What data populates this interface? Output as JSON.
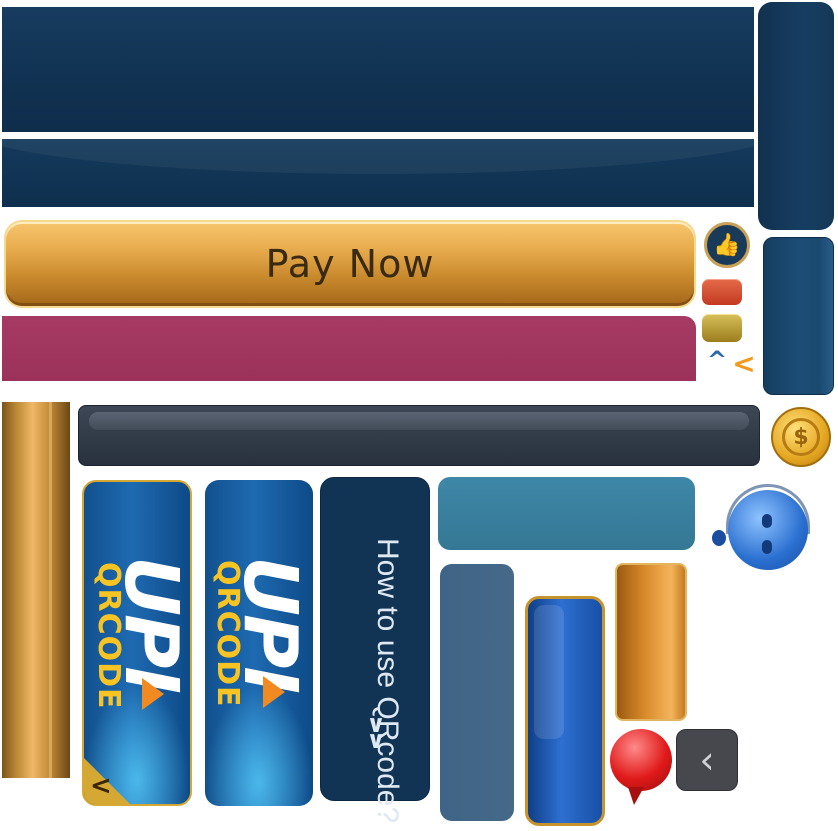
{
  "pay_button": {
    "label": "Pay Now"
  },
  "upi_cards": [
    {
      "logo_text": "UPI",
      "caption": "QRCODE"
    },
    {
      "logo_text": "UPI",
      "caption": "QRCODE"
    }
  ],
  "howto_panel": {
    "label": "How to use QRcode?",
    "chevron": "››"
  },
  "icons": {
    "thumb": "thumbs-up-icon",
    "coin": "dollar-coin-icon",
    "bot": "support-bot-icon",
    "bubble": "chat-bubble-icon",
    "back": "chevron-left-icon",
    "up": "chevron-up-icon",
    "left": "chevron-left-icon"
  },
  "colors": {
    "navy": "#10304f",
    "gold": "#e9ae50",
    "magenta": "#9b325a",
    "teal": "#3f87a8",
    "upi_yellow": "#f7c424"
  }
}
